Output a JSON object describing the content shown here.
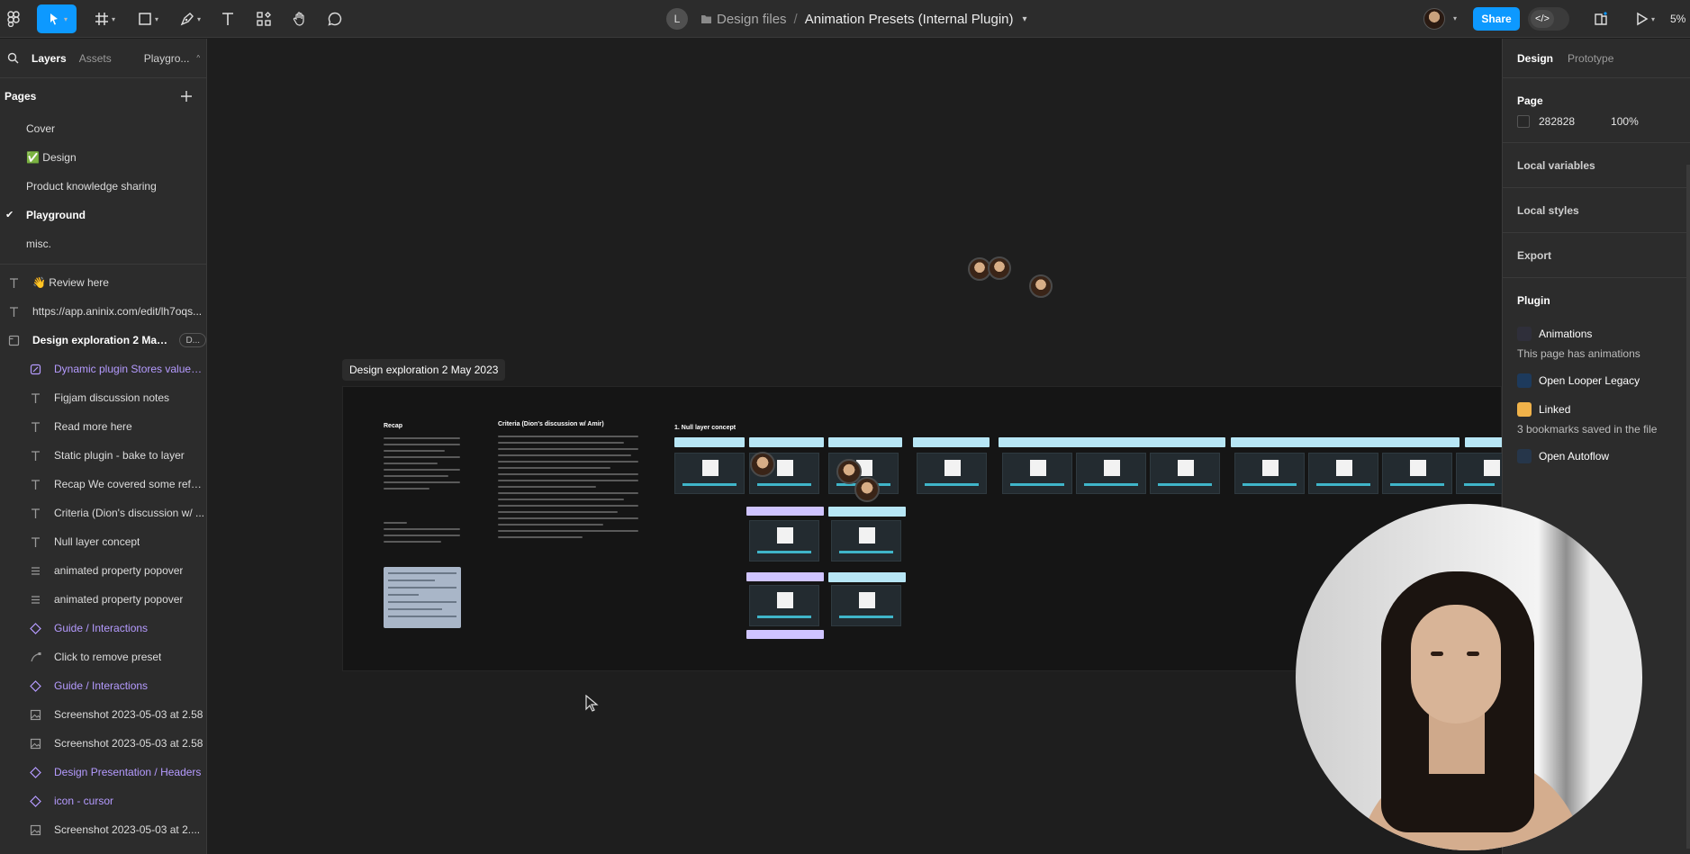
{
  "toolbar": {
    "breadcrumb_avatar": "L",
    "project": "Design files",
    "separator": "/",
    "file_name": "Animation Presets (Internal Plugin)",
    "share_label": "Share",
    "devmode_symbol": "</>",
    "zoom": "5%"
  },
  "left_panel": {
    "tabs": [
      "Layers",
      "Assets",
      "Playgro..."
    ],
    "pages_heading": "Pages",
    "pages": [
      {
        "label": "Cover"
      },
      {
        "label": "✅ Design"
      },
      {
        "label": "Product knowledge sharing"
      },
      {
        "label": "Playground",
        "current": true
      },
      {
        "label": "misc."
      }
    ],
    "layers": [
      {
        "icon": "text",
        "label": "👋 Review here"
      },
      {
        "icon": "text",
        "label": "https://app.aninix.com/edit/lh7oqs..."
      },
      {
        "icon": "section",
        "label": "Design exploration 2 May ...",
        "bold": true,
        "badge": "D..."
      },
      {
        "icon": "plugin",
        "label": "Dynamic plugin Stores values ...",
        "nested": true,
        "purple": true
      },
      {
        "icon": "text",
        "label": "Figjam discussion notes",
        "nested": true
      },
      {
        "icon": "text",
        "label": "Read more here",
        "nested": true
      },
      {
        "icon": "text",
        "label": "Static plugin - bake to layer",
        "nested": true
      },
      {
        "icon": "text",
        "label": "Recap We covered some refer...",
        "nested": true
      },
      {
        "icon": "text",
        "label": "Criteria (Dion's discussion w/ ...",
        "nested": true
      },
      {
        "icon": "text",
        "label": "Null layer concept",
        "nested": true
      },
      {
        "icon": "lines",
        "label": "animated property popover",
        "nested": true
      },
      {
        "icon": "lines",
        "label": "animated property popover",
        "nested": true
      },
      {
        "icon": "instance",
        "label": "Guide / Interactions",
        "nested": true,
        "purple": true
      },
      {
        "icon": "vector",
        "label": "Click to remove preset",
        "nested": true
      },
      {
        "icon": "instance",
        "label": "Guide / Interactions",
        "nested": true,
        "purple": true
      },
      {
        "icon": "image",
        "label": "Screenshot 2023-05-03 at 2.58",
        "nested": true
      },
      {
        "icon": "image",
        "label": "Screenshot 2023-05-03 at 2.58",
        "nested": true
      },
      {
        "icon": "instance",
        "label": "Design Presentation / Headers",
        "nested": true,
        "purple": true
      },
      {
        "icon": "instance",
        "label": "icon - cursor",
        "nested": true,
        "purple": true
      },
      {
        "icon": "image",
        "label": "Screenshot 2023-05-03 at 2....",
        "nested": true
      }
    ]
  },
  "canvas": {
    "frame_label": "Design exploration 2 May 2023",
    "recap_heading": "Recap",
    "criteria_heading": "Criteria (Dion's discussion w/ Amir)",
    "null_layer_heading": "1. Null layer concept"
  },
  "right_panel": {
    "tabs": [
      "Design",
      "Prototype"
    ],
    "page_heading": "Page",
    "page_color": "282828",
    "page_opacity": "100%",
    "local_variables": "Local variables",
    "local_styles": "Local styles",
    "export": "Export",
    "plugin_heading": "Plugin",
    "plugins": [
      {
        "name": "Animations",
        "note": "This page has animations",
        "color": "#2f2f3a"
      },
      {
        "name": "Open Looper Legacy",
        "note": "",
        "color": "#1d3a5c"
      },
      {
        "name": "Linked",
        "note": "3 bookmarks saved in the file",
        "color": "#f0b24a"
      },
      {
        "name": "Open Autoflow",
        "note": "",
        "color": "#26364a"
      }
    ]
  },
  "colors": {
    "accent": "#0d99ff",
    "canvas_bg": "#1e1e1e",
    "panel_bg": "#2c2c2c"
  }
}
